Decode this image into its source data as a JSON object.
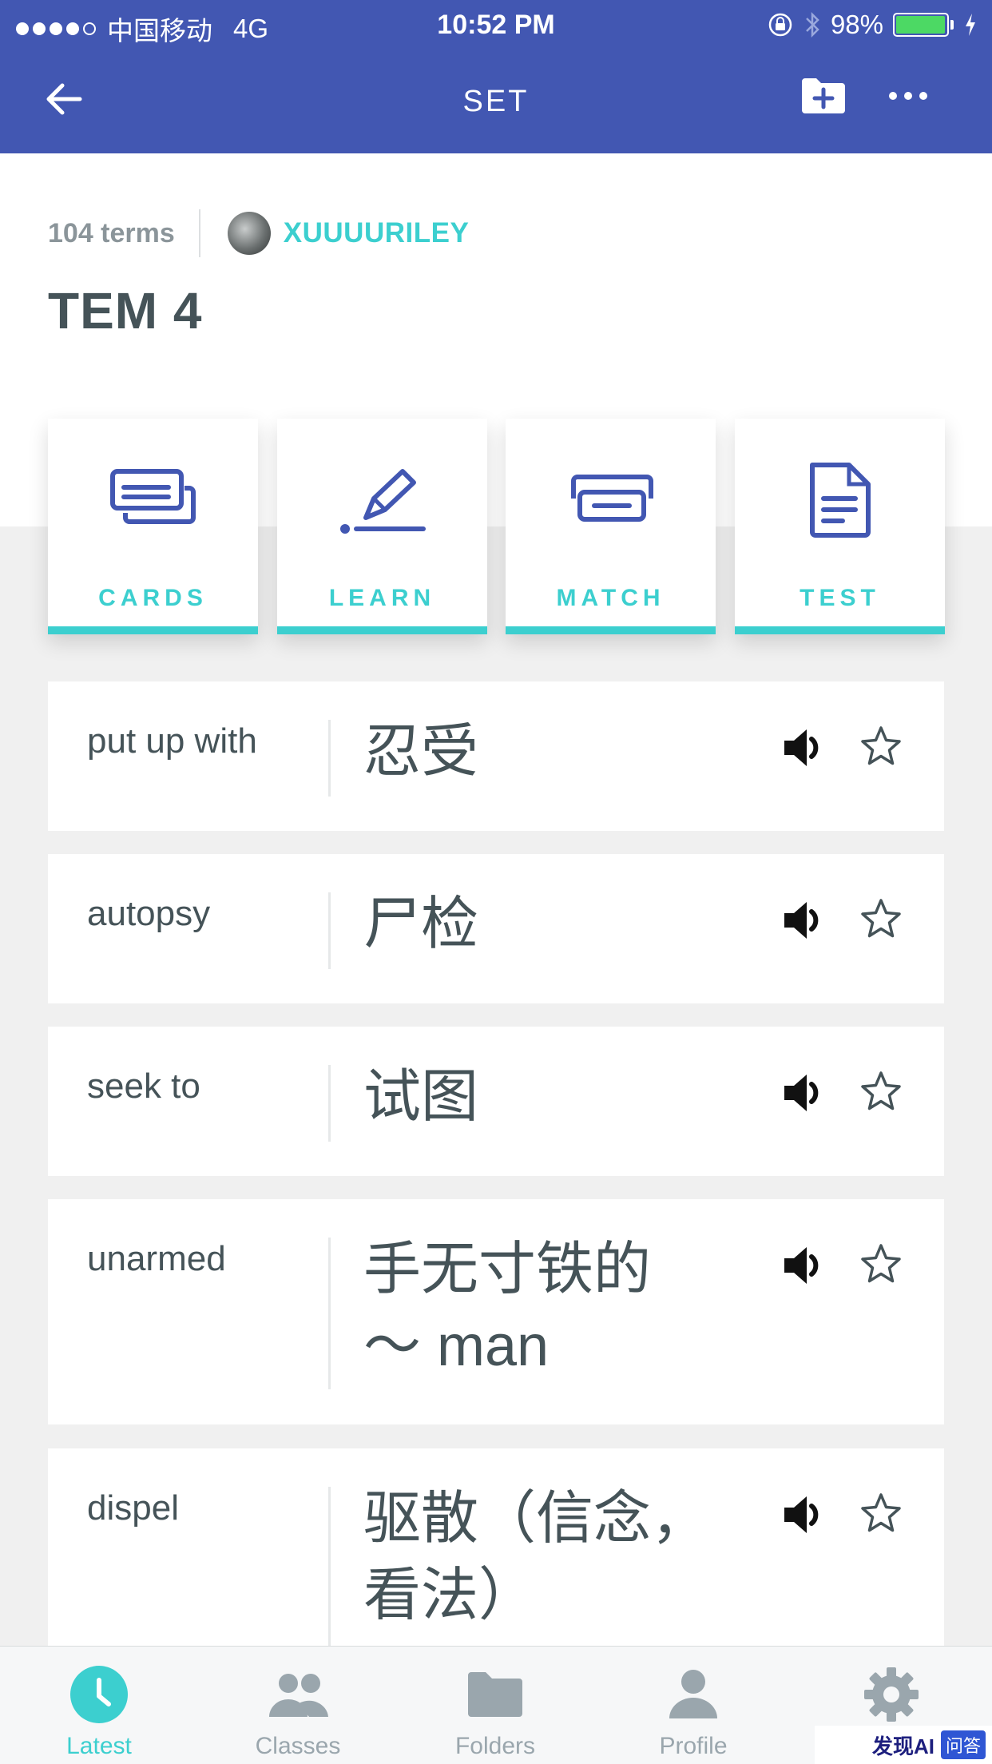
{
  "status_bar": {
    "carrier": "中国移动",
    "network": "4G",
    "time": "10:52 PM",
    "battery": "98%",
    "battery_level": 0.98
  },
  "navbar": {
    "title": "SET",
    "back_icon": "arrow-left-icon",
    "folder_icon": "folder-add-icon",
    "more_icon": "more-horizontal-icon"
  },
  "set": {
    "term_count": "104 terms",
    "author": "XUUUURILEY",
    "title": "TEM 4"
  },
  "modes": [
    {
      "label": "CARDS",
      "icon": "cards-icon"
    },
    {
      "label": "LEARN",
      "icon": "learn-pen-icon"
    },
    {
      "label": "MATCH",
      "icon": "match-icon"
    },
    {
      "label": "TEST",
      "icon": "test-document-icon"
    }
  ],
  "terms": [
    {
      "word": "put up with",
      "definition": "忍受"
    },
    {
      "word": "autopsy",
      "definition": "尸检"
    },
    {
      "word": "seek to",
      "definition": "试图"
    },
    {
      "word": "unarmed",
      "definition": "手无寸铁的 ～ man"
    },
    {
      "word": "dispel",
      "definition": "驱散（信念，看法）"
    }
  ],
  "tabbar": [
    {
      "label": "Latest",
      "icon": "clock-icon",
      "active": true
    },
    {
      "label": "Classes",
      "icon": "people-icon",
      "active": false
    },
    {
      "label": "Folders",
      "icon": "folder-icon",
      "active": false
    },
    {
      "label": "Profile",
      "icon": "person-icon",
      "active": false
    },
    {
      "label": "",
      "icon": "gear-icon",
      "active": false
    }
  ],
  "watermark": {
    "text": "发现AI",
    "badge": "问答"
  },
  "colors": {
    "primary": "#4257b2",
    "accent": "#3ccfcf",
    "text": "#455358",
    "muted": "#9aa6ad"
  }
}
